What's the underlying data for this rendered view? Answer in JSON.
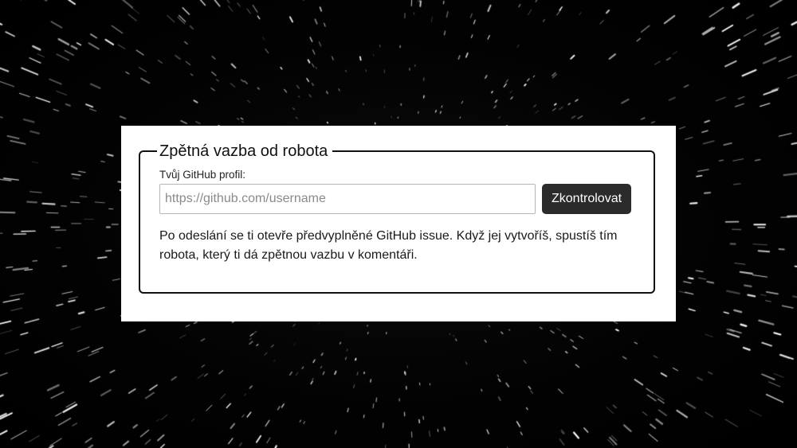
{
  "form": {
    "legend": "Zpětná vazba od robota",
    "label": "Tvůj GitHub profil:",
    "input": {
      "placeholder": "https://github.com/username",
      "value": ""
    },
    "button_label": "Zkontrolovat",
    "note": "Po odeslání se ti otevře předvyplněné GitHub issue. Když jej vytvoříš, spustíš tím robota, který ti dá zpětnou vazbu v komentáři."
  },
  "colors": {
    "background": "#000000",
    "card": "#ffffff",
    "button": "#2b2b2b",
    "border": "#111111"
  }
}
